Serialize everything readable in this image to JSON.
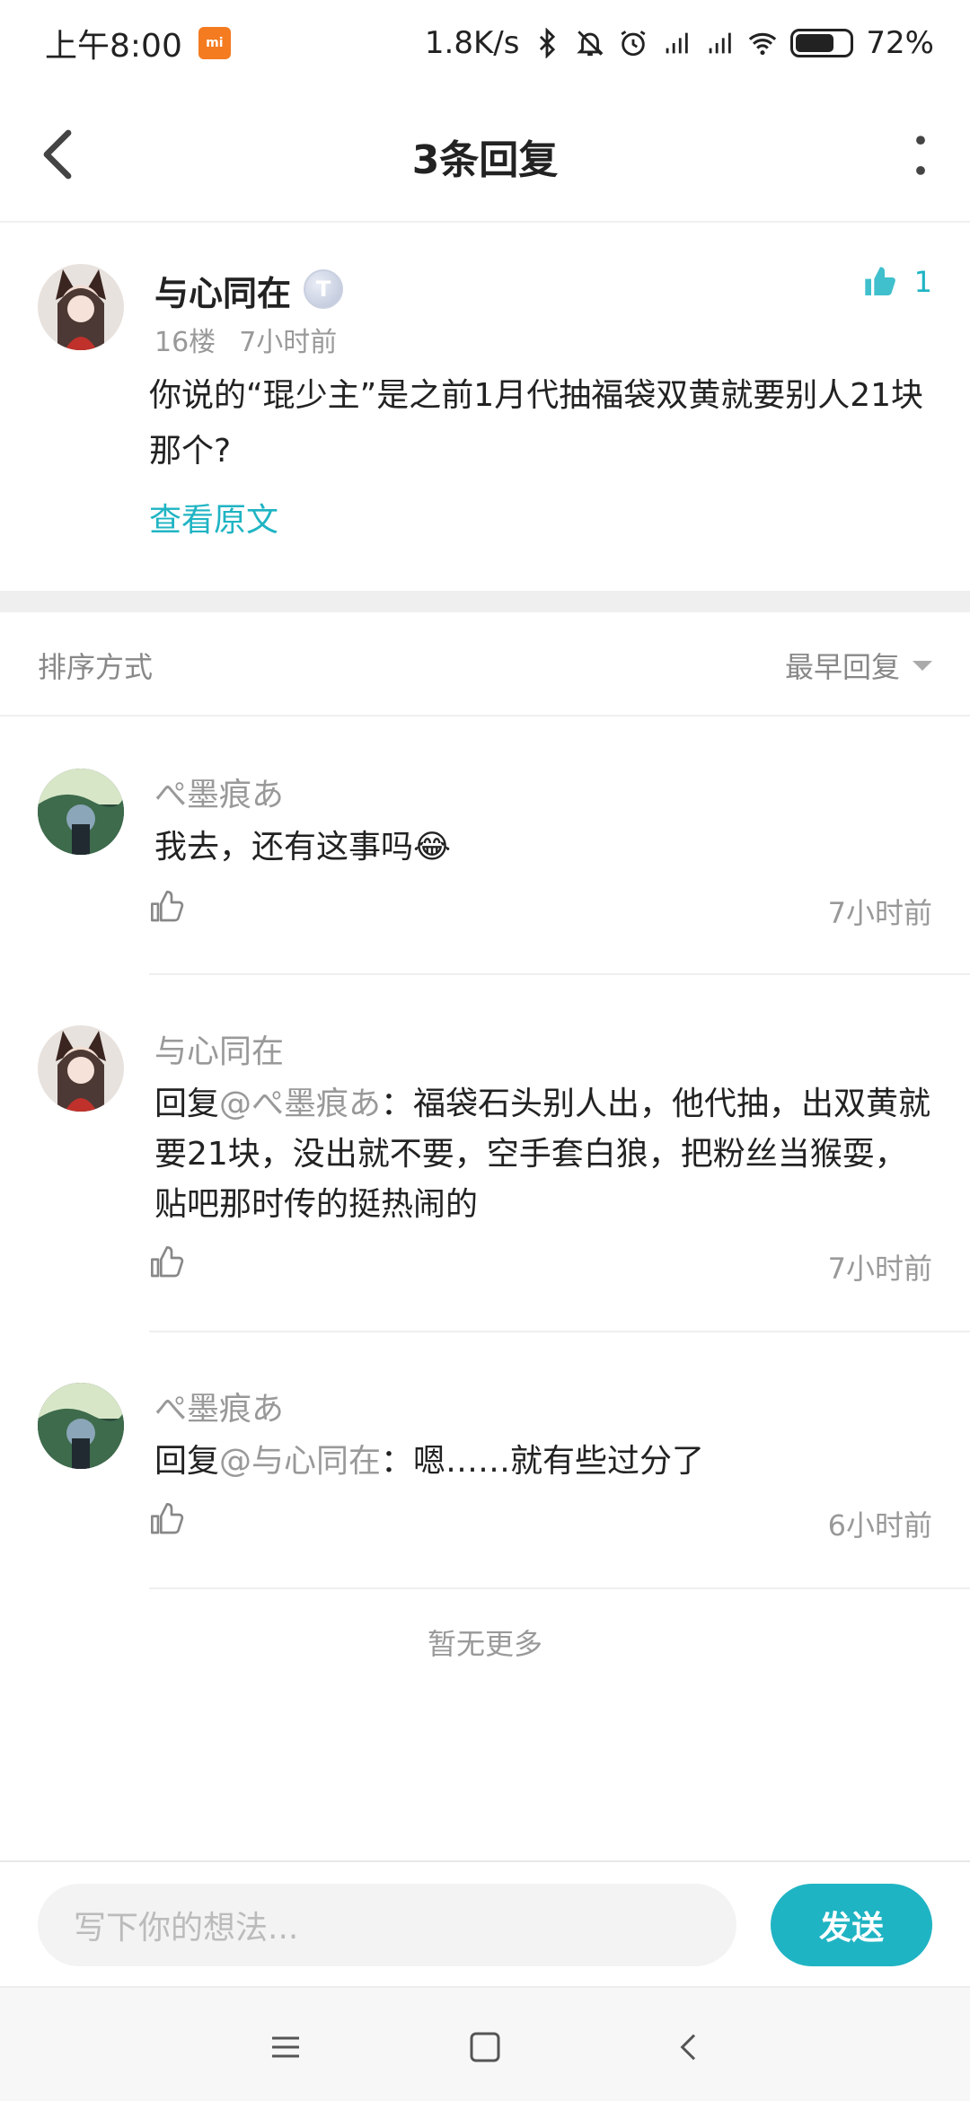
{
  "status_bar": {
    "time": "上午8:00",
    "net_speed": "1.8K/s",
    "battery_percent": "72%",
    "battery_level": 0.72,
    "icons": [
      "xiaomi-badge-icon",
      "bluetooth-icon",
      "mute-bell-icon",
      "alarm-icon",
      "signal-icon",
      "signal-icon-2",
      "wifi-icon",
      "battery-icon"
    ]
  },
  "header": {
    "title": "3条回复",
    "icons": [
      "back-arrow-icon",
      "more-vertical-icon"
    ]
  },
  "original_post": {
    "author": "与心同在",
    "level_badge": "T",
    "floor": "16楼",
    "time": "7小时前",
    "text": "你说的“琨少主”是之前1月代抽福袋双黄就要别人21块那个?",
    "like_count": "1",
    "view_original": "查看原文"
  },
  "sort": {
    "label": "排序方式",
    "value": "最早回复"
  },
  "replies": [
    {
      "author": "ぺ墨痕あ",
      "text": "我去，还有这事吗😂",
      "time": "7小时前"
    },
    {
      "author": "与心同在",
      "prefix": "回复",
      "mention": "@ぺ墨痕あ",
      "text": "：福袋石头别人出，他代抽，出双黄就要21块，没出就不要，空手套白狼，把粉丝当猴耍，贴吧那时传的挺热闹的",
      "time": "7小时前"
    },
    {
      "author": "ぺ墨痕あ",
      "prefix": "回复",
      "mention": "@与心同在",
      "text": "：嗯……就有些过分了",
      "time": "6小时前"
    }
  ],
  "no_more": "暂无更多",
  "composer": {
    "placeholder": "写下你的想法...",
    "send_label": "发送"
  },
  "colors": {
    "accent": "#1fb4c3",
    "muted_text": "#999999",
    "divider": "#efefef"
  }
}
